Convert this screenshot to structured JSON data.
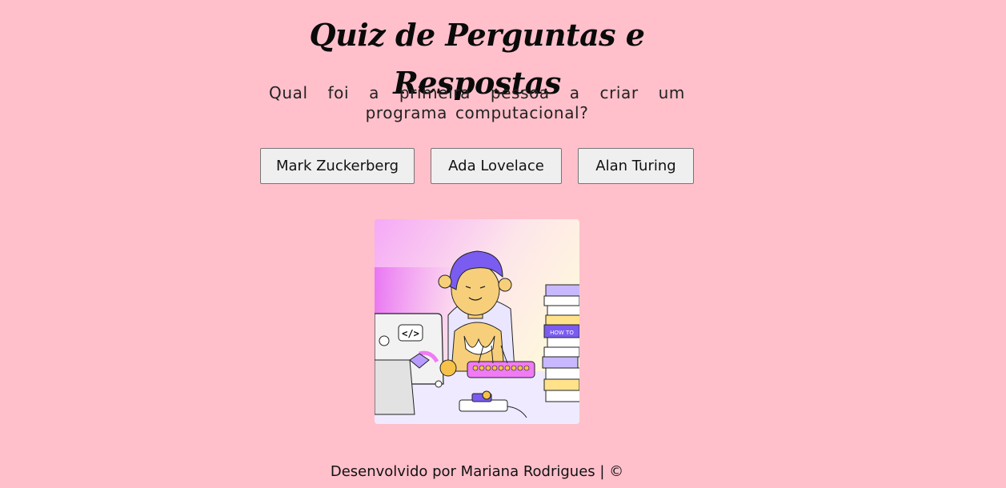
{
  "header": {
    "title": "Quiz de Perguntas e Respostas"
  },
  "quiz": {
    "question": "Qual foi a primeira pessoa a criar um programa computacional?",
    "answers": [
      {
        "label": "Mark Zuckerberg"
      },
      {
        "label": "Ada Lovelace"
      },
      {
        "label": "Alan Turing"
      }
    ]
  },
  "illustration": {
    "description_icon": "woman-programmer-illustration",
    "code_sticker_text": "</>",
    "book_spine_text": "HOW TO"
  },
  "footer": {
    "text": "Desenvolvido por Mariana Rodrigues | ©"
  },
  "colors": {
    "background": "#ffc0cb",
    "button_bg": "#efefef",
    "button_border": "#767676",
    "accent_purple": "#7b5cf0",
    "accent_pink": "#f07bf5"
  }
}
